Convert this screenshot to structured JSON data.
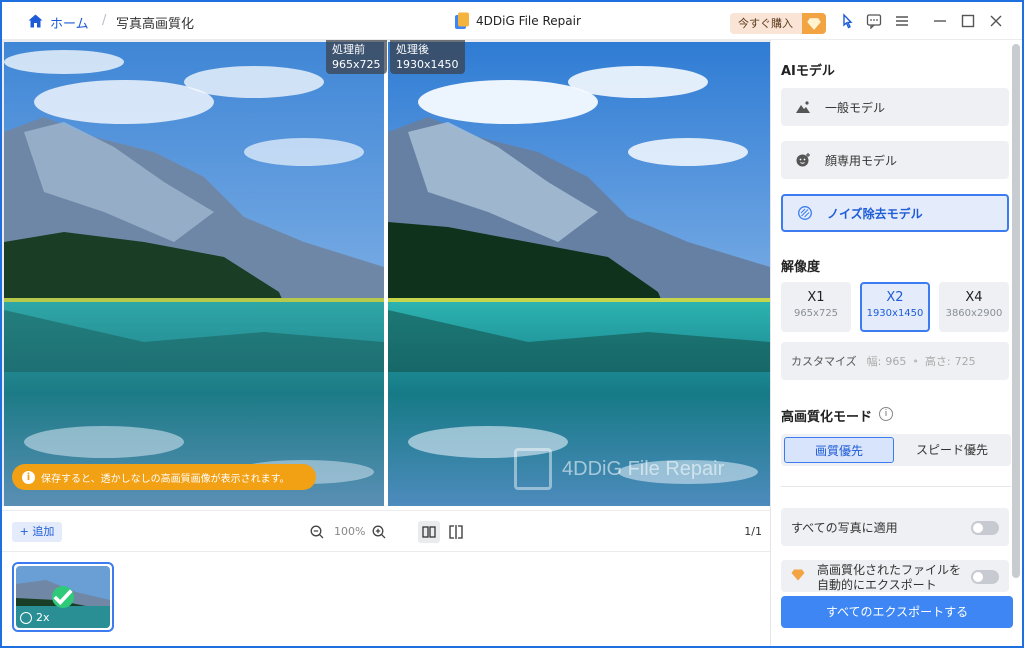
{
  "breadcrumb": {
    "home": "ホーム",
    "separator": "/",
    "current": "写真高画質化"
  },
  "app": {
    "title": "4DDiG File Repair"
  },
  "header": {
    "buy_label": "今すぐ購入"
  },
  "preview": {
    "before_label": "処理前",
    "before_size": "965x725",
    "after_label": "処理後",
    "after_size": "1930x1450",
    "watermark": "4DDiG File Repair",
    "notice": "保存すると、透かしなしの高画質画像が表示されます。"
  },
  "toolbar": {
    "add_label": "追加",
    "zoom": "100%",
    "page": "1/1"
  },
  "thumbnail": {
    "scale_badge": "2x"
  },
  "panel": {
    "ai_model_title": "AIモデル",
    "models": [
      {
        "label": "一般モデル",
        "icon": "landscape-icon"
      },
      {
        "label": "顔専用モデル",
        "icon": "face-icon"
      },
      {
        "label": "ノイズ除去モデル",
        "icon": "noise-icon"
      }
    ],
    "resolution_title": "解像度",
    "resolutions": [
      {
        "scale": "X1",
        "dim": "965x725"
      },
      {
        "scale": "X2",
        "dim": "1930x1450"
      },
      {
        "scale": "X4",
        "dim": "3860x2900"
      }
    ],
    "custom": {
      "label": "カスタマイズ",
      "w_label": "幅:",
      "w_value": "965",
      "h_label": "高さ:",
      "h_value": "725"
    },
    "mode_title": "高画質化モード",
    "modes": {
      "quality": "画質優先",
      "speed": "スピード優先"
    },
    "apply_all": "すべての写真に適用",
    "auto_export": "高画質化されたファイルを自動的にエクスポート",
    "export_all": "すべてのエクスポートする"
  },
  "colors": {
    "accent": "#3d86f4",
    "notice": "#f2a014",
    "success": "#2fc97a"
  }
}
